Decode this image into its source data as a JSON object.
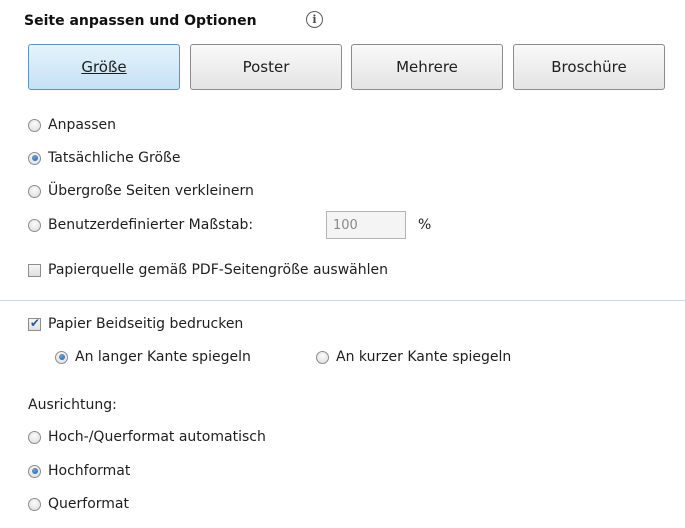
{
  "header": {
    "title": "Seite anpassen und Optionen",
    "info_icon_glyph": "i"
  },
  "tabs": [
    {
      "label": "Größe",
      "active": true
    },
    {
      "label": "Poster",
      "active": false
    },
    {
      "label": "Mehrere",
      "active": false
    },
    {
      "label": "Broschüre",
      "active": false
    }
  ],
  "scaling": {
    "options": [
      {
        "label": "Anpassen",
        "checked": false
      },
      {
        "label": "Tatsächliche Größe",
        "checked": true
      },
      {
        "label": "Übergroße Seiten verkleinern",
        "checked": false
      },
      {
        "label": "Benutzerdefinierter Maßstab:",
        "checked": false
      }
    ],
    "custom_value": "100",
    "custom_unit": "%",
    "paper_source": {
      "label": "Papierquelle gemäß PDF-Seitengröße auswählen",
      "checked": false
    }
  },
  "duplex": {
    "label": "Papier Beidseitig bedrucken",
    "checked": true,
    "options": [
      {
        "label": "An langer Kante spiegeln",
        "checked": true
      },
      {
        "label": "An kurzer Kante spiegeln",
        "checked": false
      }
    ]
  },
  "orientation": {
    "label": "Ausrichtung:",
    "options": [
      {
        "label": "Hoch-/Querformat automatisch",
        "checked": false
      },
      {
        "label": "Hochformat",
        "checked": true
      },
      {
        "label": "Querformat",
        "checked": false
      }
    ]
  },
  "colors": {
    "tab_active_border": "#5f95c5",
    "tab_active_bg": "#c4e1f5",
    "radio_dot": "#1c5ea8",
    "divider": "#c9d8e6"
  }
}
